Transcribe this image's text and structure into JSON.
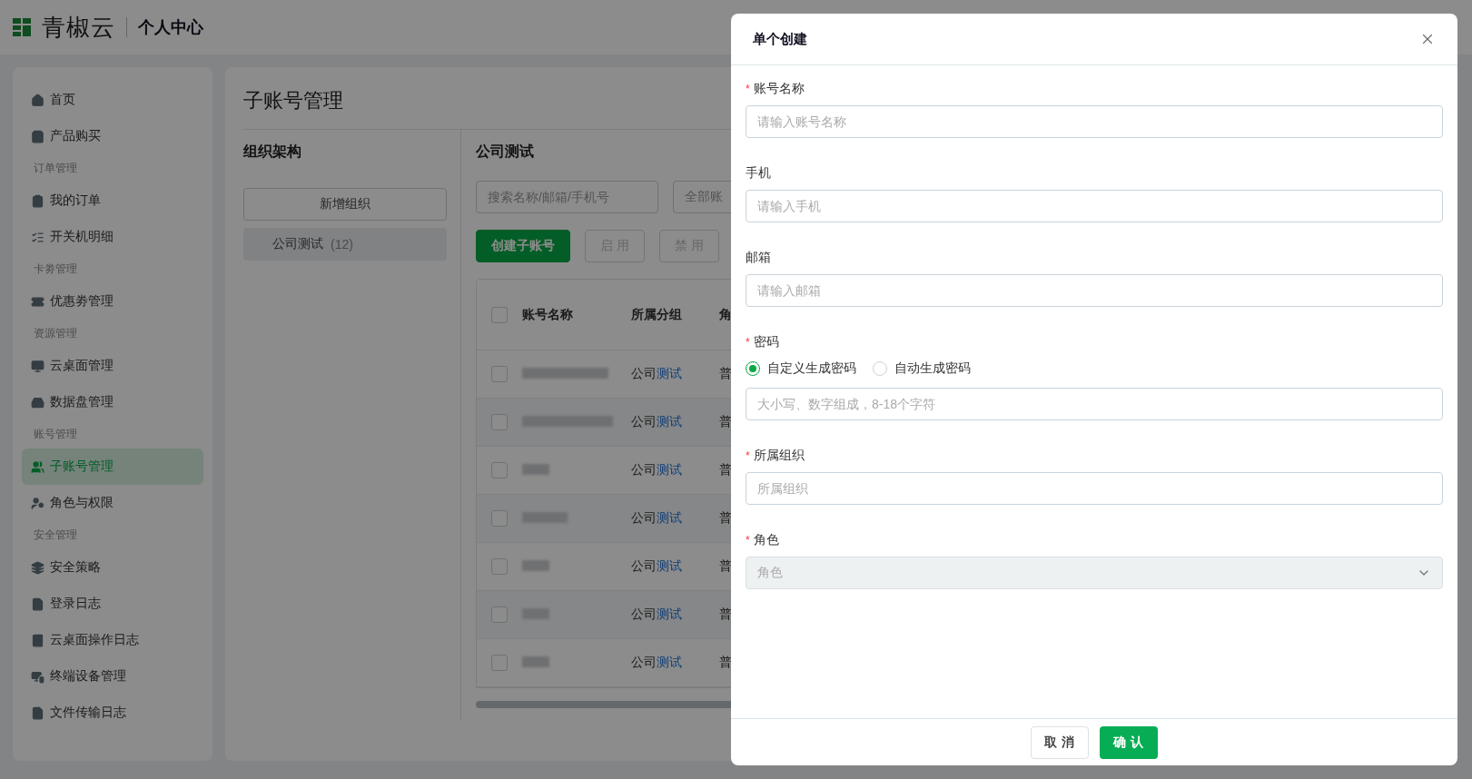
{
  "header": {
    "logo_text": "青椒云",
    "title": "个人中心"
  },
  "sidebar": {
    "items": [
      {
        "kind": "item",
        "label": "首页",
        "selected": false
      },
      {
        "kind": "item",
        "label": "产品购买",
        "selected": false
      },
      {
        "kind": "group",
        "label": "订单管理"
      },
      {
        "kind": "item",
        "label": "我的订单",
        "selected": false
      },
      {
        "kind": "item",
        "label": "开关机明细",
        "selected": false
      },
      {
        "kind": "group",
        "label": "卡劵管理"
      },
      {
        "kind": "item",
        "label": "优惠劵管理",
        "selected": false
      },
      {
        "kind": "group",
        "label": "资源管理"
      },
      {
        "kind": "item",
        "label": "云桌面管理",
        "selected": false
      },
      {
        "kind": "item",
        "label": "数据盘管理",
        "selected": false
      },
      {
        "kind": "group",
        "label": "账号管理"
      },
      {
        "kind": "item",
        "label": "子账号管理",
        "selected": true
      },
      {
        "kind": "item",
        "label": "角色与权限",
        "selected": false
      },
      {
        "kind": "group",
        "label": "安全管理"
      },
      {
        "kind": "item",
        "label": "安全策略",
        "selected": false
      },
      {
        "kind": "item",
        "label": "登录日志",
        "selected": false
      },
      {
        "kind": "item",
        "label": "云桌面操作日志",
        "selected": false
      },
      {
        "kind": "item",
        "label": "终端设备管理",
        "selected": false
      },
      {
        "kind": "item",
        "label": "文件传输日志",
        "selected": false
      }
    ]
  },
  "page": {
    "title": "子账号管理",
    "org_panel": {
      "title": "组织架构",
      "add_button": "新增组织",
      "items": [
        {
          "label": "公司测试",
          "count": "(12)",
          "selected": true
        }
      ]
    },
    "list_panel": {
      "title": "公司测试",
      "search": {
        "placeholder": "搜索名称/邮箱/手机号"
      },
      "filter": "全部账",
      "buttons": [
        {
          "label": "创建子账号",
          "kind": "primary"
        },
        {
          "label": "启 用",
          "kind": "disabled"
        },
        {
          "label": "禁 用",
          "kind": "disabled"
        }
      ],
      "table": {
        "header_checked": false,
        "columns": [
          "账号名称",
          "所属分组",
          "角"
        ],
        "rows": [
          {
            "checked": false,
            "group": [
              {
                "text": "公司",
                "highlight": false
              },
              {
                "text": "测试",
                "highlight": true
              }
            ],
            "column_3": "普"
          },
          {
            "checked": false,
            "group": [
              {
                "text": "公司",
                "highlight": false
              },
              {
                "text": "测试",
                "highlight": true
              }
            ],
            "column_3": "普"
          },
          {
            "checked": false,
            "group": [
              {
                "text": "公司",
                "highlight": false
              },
              {
                "text": "测试",
                "highlight": true
              }
            ],
            "column_3": "普"
          },
          {
            "checked": false,
            "group": [
              {
                "text": "公司",
                "highlight": false
              },
              {
                "text": "测试",
                "highlight": true
              }
            ],
            "column_3": "普"
          },
          {
            "checked": false,
            "group": [
              {
                "text": "公司",
                "highlight": false
              },
              {
                "text": "测试",
                "highlight": true
              }
            ],
            "column_3": "普"
          },
          {
            "checked": false,
            "group": [
              {
                "text": "公司",
                "highlight": false
              },
              {
                "text": "测试",
                "highlight": true
              }
            ],
            "column_3": "普"
          },
          {
            "checked": false,
            "group": [
              {
                "text": "公司",
                "highlight": false
              },
              {
                "text": "测试",
                "highlight": true
              }
            ],
            "column_3": "普"
          }
        ]
      }
    }
  },
  "modal": {
    "title": "单个创建",
    "fields": [
      {
        "kind": "text",
        "label": "账号名称",
        "required_mark": "*",
        "placeholder": "请输入账号名称"
      },
      {
        "kind": "text",
        "label": "手机",
        "placeholder": "请输入手机"
      },
      {
        "kind": "text",
        "label": "邮箱",
        "placeholder": "请输入邮箱"
      },
      {
        "kind": "radio",
        "label": "密码",
        "required_mark": "*",
        "options": [
          {
            "label": "自定义生成密码",
            "selected": true
          },
          {
            "label": "自动生成密码",
            "selected": false
          }
        ],
        "placeholder": "大小写、数字组成，8-18个字符"
      },
      {
        "kind": "text",
        "label": "所属组织",
        "required_mark": "*",
        "placeholder": "所属组织"
      },
      {
        "kind": "select",
        "label": "角色",
        "required_mark": "*",
        "placeholder": "角色",
        "disabled": true
      }
    ],
    "buttons": [
      {
        "label": "取 消",
        "kind": "secondary"
      },
      {
        "label": "确 认",
        "kind": "primary"
      }
    ]
  }
}
